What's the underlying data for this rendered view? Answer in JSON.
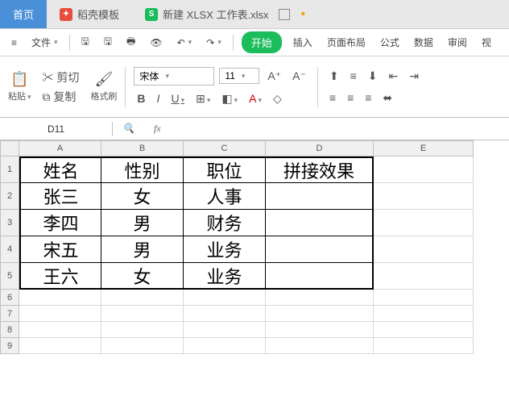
{
  "tabs": {
    "home": "首页",
    "template": "稻壳模板",
    "sheet_icon": "S",
    "sheet_name": "新建 XLSX 工作表.xlsx"
  },
  "menu": {
    "file": "文件",
    "undo_tip": "↶",
    "redo_tip": "↷",
    "start": "开始",
    "insert": "插入",
    "layout": "页面布局",
    "formula": "公式",
    "data": "数据",
    "review": "审阅",
    "view": "视"
  },
  "ribbon": {
    "paste": "粘贴",
    "cut": "剪切",
    "copy": "复制",
    "format_painter": "格式刷",
    "font_name": "宋体",
    "font_size": "11",
    "bold": "B",
    "italic": "I",
    "underline": "U",
    "inc_font": "A",
    "dec_font": "A"
  },
  "namebox": {
    "cell_ref": "D11",
    "fx": "fx",
    "formula": ""
  },
  "grid": {
    "columns": [
      "A",
      "B",
      "C",
      "D",
      "E"
    ],
    "headers": [
      "姓名",
      "性别",
      "职位",
      "拼接效果"
    ],
    "rows": [
      [
        "张三",
        "女",
        "人事",
        ""
      ],
      [
        "李四",
        "男",
        "财务",
        ""
      ],
      [
        "宋五",
        "男",
        "业务",
        ""
      ],
      [
        "王六",
        "女",
        "业务",
        ""
      ]
    ],
    "row_numbers": [
      1,
      2,
      3,
      4,
      5,
      6,
      7,
      8,
      9
    ]
  }
}
